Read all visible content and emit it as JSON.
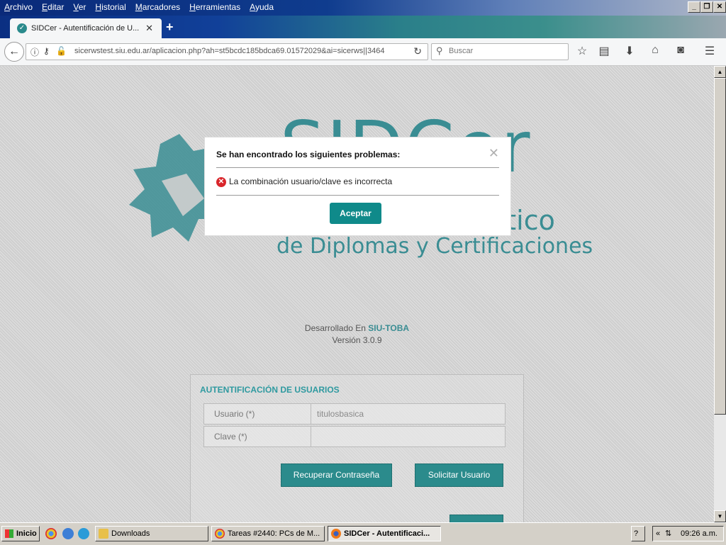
{
  "browser": {
    "menu": [
      "Archivo",
      "Editar",
      "Ver",
      "Historial",
      "Marcadores",
      "Herramientas",
      "Ayuda"
    ],
    "tab_title": "SIDCer - Autentificación de U...",
    "url": "sicerwstest.siu.edu.ar/aplicacion.php?ah=st5bcdc185bdca69.01572029&ai=sicerws||3464",
    "search_placeholder": "Buscar"
  },
  "page": {
    "logo_big": "SIDCer",
    "logo_mid": "ático",
    "logo_sub": "de Diplomas y Certificaciones",
    "dev_prefix": "Desarrollado En",
    "dev_brand": "SIU-TOBA",
    "version": "Versión 3.0.9",
    "auth_header": "AUTENTIFICACIÓN DE USUARIOS",
    "usuario_label": "Usuario (*)",
    "usuario_value": "titulosbasica",
    "clave_label": "Clave (*)",
    "recover_button": "Recuperar Contraseña",
    "request_button": "Solicitar Usuario"
  },
  "modal": {
    "title": "Se han encontrado los siguientes problemas:",
    "error": "La combinación usuario/clave es incorrecta",
    "accept": "Aceptar"
  },
  "taskbar": {
    "start": "Inicio",
    "items": [
      "Downloads",
      "Tareas #2440: PCs de M...",
      "SIDCer - Autentificaci..."
    ],
    "clock": "09:26 a.m."
  },
  "colors": {
    "accent": "#2b8b8c",
    "error": "#d9262b"
  }
}
